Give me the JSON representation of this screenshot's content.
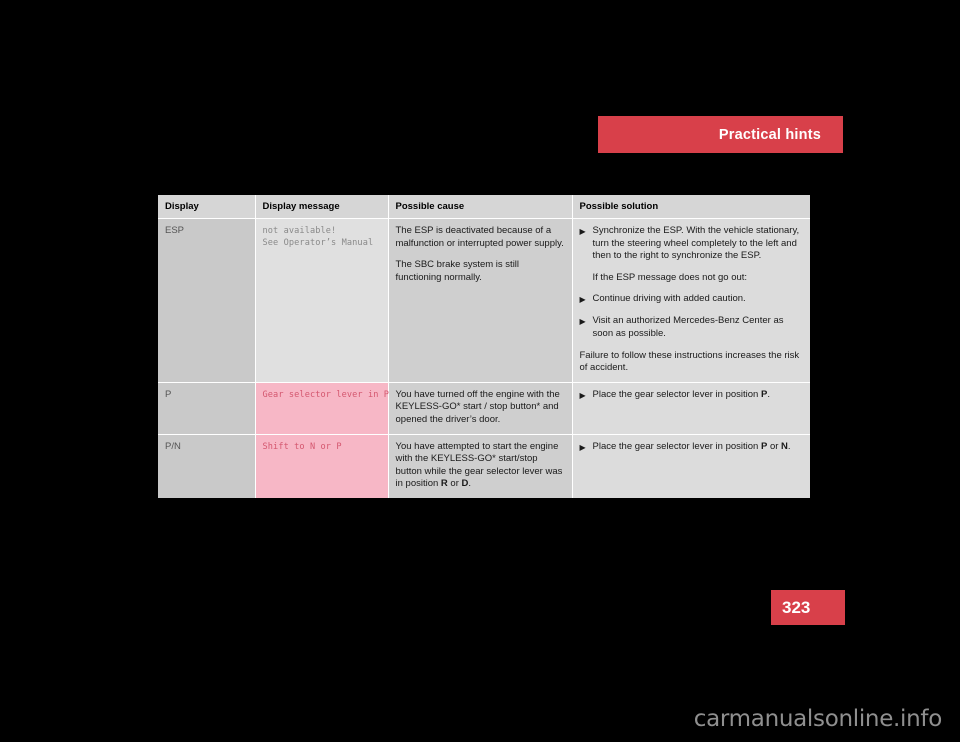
{
  "chapter": {
    "title": "Practical hints",
    "banner_color": "#d8404a"
  },
  "page": {
    "number": "323",
    "number_block_color": "#d8404a"
  },
  "watermark": {
    "text": "carmanualsonline.info"
  },
  "table": {
    "headers": {
      "display": "Display",
      "message": "Display message",
      "cause": "Possible cause",
      "solution": "Possible solution"
    },
    "rows": [
      {
        "display": "ESP",
        "message_lines": [
          "not available!",
          "See Operator’s Manual"
        ],
        "message_style": "gray",
        "cause_paragraphs": [
          "The ESP is deactivated because of a malfunction or interrupted power supply.",
          "The SBC brake system is still functioning normally."
        ],
        "solution_items": [
          {
            "type": "bullet",
            "text": "Synchronize the ESP. With the vehicle stationary, turn the steering wheel completely to the left and then to the right to synchronize the ESP."
          },
          {
            "type": "plain",
            "text": "If the ESP message does not go out:"
          },
          {
            "type": "bullet",
            "text": "Continue driving with added caution."
          },
          {
            "type": "bullet",
            "text": "Visit an authorized Mercedes-Benz Center as soon as possible."
          },
          {
            "type": "plain-flush",
            "text": "Failure to follow these instructions increases the risk of accident."
          }
        ]
      },
      {
        "display": "P",
        "message_lines": [
          "Gear selector lever in P"
        ],
        "message_style": "pink",
        "cause_paragraphs": [
          "You have turned off the engine with the KEYLESS-GO* start / stop button* and opened the driver’s door."
        ],
        "solution_items": [
          {
            "type": "bullet",
            "text": "Place the gear selector lever in position P.",
            "bold_tokens": [
              "P"
            ]
          }
        ]
      },
      {
        "display": "P/N",
        "message_lines": [
          "Shift to N or P"
        ],
        "message_style": "pink",
        "cause_paragraphs": [
          "You have attempted to start the engine with the KEYLESS-GO* start/stop button while the gear selector lever was in position R or D.",
          "__bold__R__D__"
        ],
        "cause_html": "You have attempted to start the engine with the KEYLESS-GO* start/stop button while the gear selector lever was in position <b>R</b> or <b>D</b>.",
        "solution_items": [
          {
            "type": "bullet",
            "text": "Place the gear selector lever in position P or N.",
            "bold_tokens": [
              "P",
              "N"
            ]
          }
        ]
      }
    ]
  },
  "icons": {
    "bullet_marker": "▶"
  }
}
